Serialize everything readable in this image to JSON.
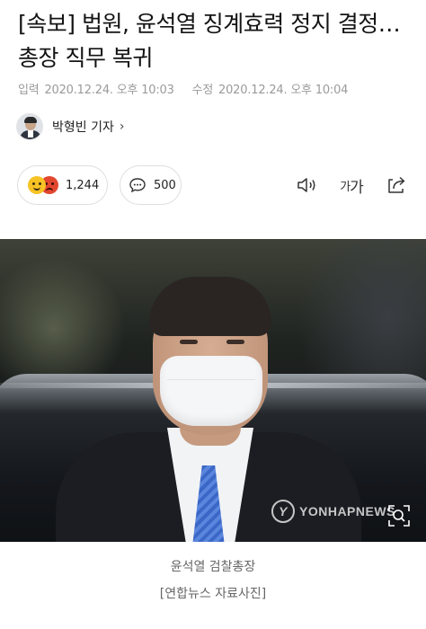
{
  "article": {
    "headline": "[속보] 법원, 윤석열 징계효력 정지 결정…총장 직무 복귀",
    "input_label": "입력",
    "input_time": "2020.12.24. 오후 10:03",
    "modified_label": "수정",
    "modified_time": "2020.12.24. 오후 10:04"
  },
  "reporter": {
    "name": "박형빈 기자",
    "chevron": "›"
  },
  "reactions": {
    "count": "1,244",
    "icons": [
      "smile-face",
      "angry-face"
    ]
  },
  "comments": {
    "count": "500",
    "icon": "speech-bubble"
  },
  "toolbar": {
    "font_small": "가",
    "font_big": "가",
    "icons": [
      "speaker",
      "font-size",
      "share"
    ]
  },
  "photo": {
    "watermark_text": "YONHAPNEWS",
    "watermark_logo": "Y",
    "caption_line1": "윤석열 검찰총장",
    "caption_line2": "[연합뉴스 자료사진]"
  },
  "colors": {
    "meta_gray": "#9a9a9a",
    "border_gray": "#dedede",
    "emoji_yellow": "#f7c325",
    "emoji_red": "#e2472f",
    "tie_blue": "#3b68c7"
  }
}
